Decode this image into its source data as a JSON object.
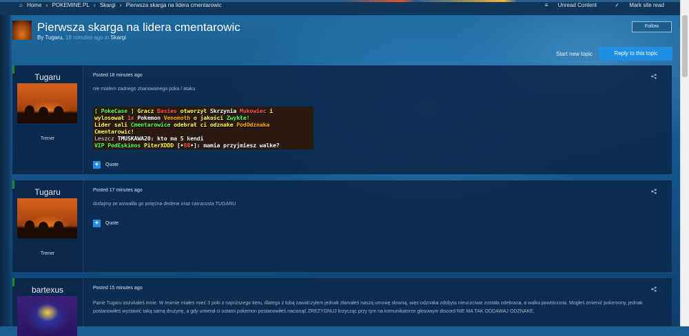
{
  "colors": {
    "accent": "#1f8fe6",
    "online_indicator": "#22d21e",
    "post_bg": "#0c2a4e",
    "chat_yellow": "#ffff55",
    "chat_red": "#ff5555",
    "chat_green": "#55ff55",
    "chat_gold": "#ffaa00",
    "chat_white": "#ffffff",
    "chat_gray": "#aaaaaa"
  },
  "breadcrumb": [
    "Home",
    "POKEMINE.PL",
    "Skargi",
    "Pierwsza skarga na lidera cmentarowic"
  ],
  "top_links": {
    "unread": "Unread Content",
    "mark_read": "Mark site read"
  },
  "topic": {
    "title": "Pierwsza skarga na lidera cmentarowic",
    "by": "By",
    "author": "Tugaru",
    "time": "18 minutes ago",
    "in": "in",
    "forum": "Skargi"
  },
  "actions": {
    "follow": "Follow",
    "start_new_topic": "Start new topic",
    "reply": "Reply to this topic"
  },
  "posts": [
    {
      "author": "Tugaru",
      "rank": "Trener",
      "time": "Posted 18 minutes ago",
      "text": "nie mialem zadnego zbanowanego poka / ataku",
      "quote": "Quote",
      "chat": [
        {
          "segments": [
            {
              "t": "[ PokeCase ] ",
              "c": "#55ff55"
            },
            {
              "t": "Gracz ",
              "c": "#ffff55"
            },
            {
              "t": "Basies",
              "c": "#ff5555"
            },
            {
              "t": " otworzył ",
              "c": "#ffff55"
            },
            {
              "t": "Skrzynia ",
              "c": "#ffffff"
            },
            {
              "t": "Mukowiec",
              "c": "#ff5555"
            },
            {
              "t": " i",
              "c": "#ffff55"
            }
          ]
        },
        {
          "segments": [
            {
              "t": "wylosował ",
              "c": "#ffff55"
            },
            {
              "t": "1x ",
              "c": "#ff5555"
            },
            {
              "t": "Pokemon ",
              "c": "#ffffff"
            },
            {
              "t": "Venomoth",
              "c": "#ffaa00"
            },
            {
              "t": " o jakości ",
              "c": "#ffff55"
            },
            {
              "t": "Zwykłe!",
              "c": "#55ff55"
            }
          ]
        },
        {
          "segments": [
            {
              "t": "Lider sali ",
              "c": "#ffff55"
            },
            {
              "t": "Cmentarowice",
              "c": "#55ff55"
            },
            {
              "t": " odebrał ci odznake ",
              "c": "#ffff55"
            },
            {
              "t": "PodOdznaka",
              "c": "#ffaa00"
            }
          ]
        },
        {
          "segments": [
            {
              "t": "Cmentarowic!",
              "c": "#ffff55"
            }
          ]
        },
        {
          "segments": [
            {
              "t": "Leszcz ",
              "c": "#aaaaaa"
            },
            {
              "t": "TMUSKAWA20: kto ma 5 kendi",
              "c": "#ffffff"
            }
          ]
        },
        {
          "segments": [
            {
              "t": "VIP ",
              "c": "#55ff55"
            },
            {
              "t": "PodEskimos ",
              "c": "#55ff55"
            },
            {
              "t": "PiterXDDD ",
              "c": "#ffff55"
            },
            {
              "t": "[•",
              "c": "#ffffff"
            },
            {
              "t": "88",
              "c": "#ff5555"
            },
            {
              "t": "•]: mamia przyjmiesz walke?",
              "c": "#ffffff"
            }
          ]
        }
      ]
    },
    {
      "author": "Tugaru",
      "rank": "Trener",
      "time": "Posted 17 minutes ago",
      "text": "dodajmy ze wzwaliła go potężna dedene oraz carracosta TUGARU",
      "quote": "Quote"
    },
    {
      "author": "bartexus",
      "time": "Posted 15 minutes ago",
      "text": "Panie Tugaru oszukałeś mnie. W teamie miałeś mieć 3 poki z najniższego tieru, dlatego z tobą zawalczyłem jednak złamałeś naszą umowę słowną, więc odznaka zdobyta nieuczciwie została odebrana, a walka powtórzona. Mogłeś zmienić pokemony, jednak postanowiłeś wystawić taką samą drużynę, a gdy umierał ci ostatni pokemon postanowiłeś nacisnąć ZREZYGNUJ krzycząc przy tym na komunikatorze głosowym discord NIE MA TAK ODDAWAJ ODZNAKE."
    }
  ]
}
